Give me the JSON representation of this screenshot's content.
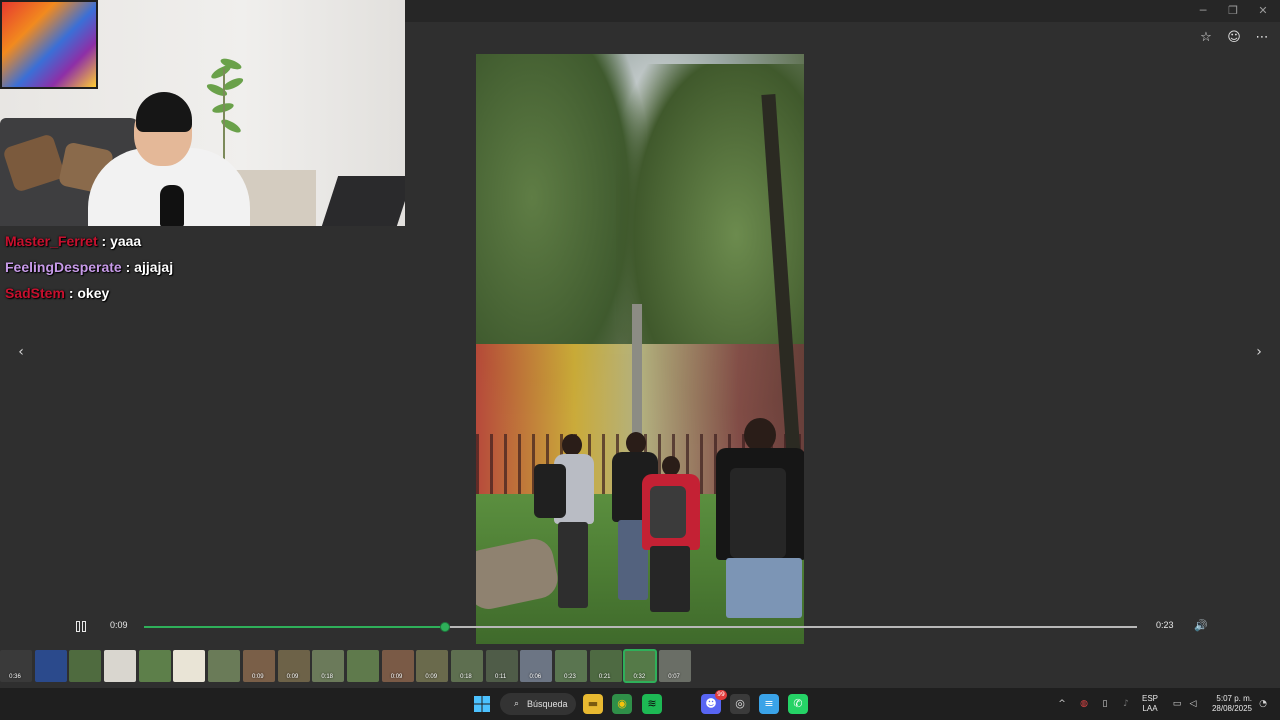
{
  "window": {
    "minimize_glyph": "─",
    "maximize_glyph": "❐",
    "close_glyph": "✕"
  },
  "toolbar": {
    "favorite_icon": "star-icon",
    "favorite_glyph": "☆",
    "emoji_icon": "smiley-icon",
    "emoji_glyph": "☺",
    "more_icon": "ellipsis-icon",
    "more_glyph": "⋯"
  },
  "chat": {
    "messages": [
      {
        "user": "Master_Ferret",
        "user_color": "#c8102e",
        "separator": ":",
        "text": "yaaa"
      },
      {
        "user": "FeelingDesperate",
        "user_color": "#c79ae8",
        "separator": ":",
        "text": "ajjajaj"
      },
      {
        "user": "SadStem",
        "user_color": "#c8102e",
        "separator": ":",
        "text": "okey"
      }
    ]
  },
  "nav": {
    "prev_glyph": "‹",
    "next_glyph": "›"
  },
  "player": {
    "current_time": "0:09",
    "total_time": "0:23",
    "progress": 0.303,
    "volume_glyph": "🔊",
    "accent_color": "#2fb05a"
  },
  "filmstrip": {
    "thumbnails": [
      {
        "duration": "0:36",
        "color": "#3a3a3a",
        "selected": false
      },
      {
        "duration": "",
        "color": "#2b4a8c",
        "selected": false
      },
      {
        "duration": "",
        "color": "#4f6b3f",
        "selected": false
      },
      {
        "duration": "",
        "color": "#d9d6cf",
        "selected": false
      },
      {
        "duration": "",
        "color": "#5d7f4a",
        "selected": false
      },
      {
        "duration": "",
        "color": "#e9e4d6",
        "selected": false
      },
      {
        "duration": "",
        "color": "#6a7b58",
        "selected": false
      },
      {
        "duration": "0:09",
        "color": "#7a5f48",
        "selected": false
      },
      {
        "duration": "0:09",
        "color": "#6d6248",
        "selected": false
      },
      {
        "duration": "0:18",
        "color": "#6b7a5a",
        "selected": false
      },
      {
        "duration": "",
        "color": "#5f7a4c",
        "selected": false
      },
      {
        "duration": "0:09",
        "color": "#7a5a46",
        "selected": false
      },
      {
        "duration": "0:09",
        "color": "#6a6a4c",
        "selected": false
      },
      {
        "duration": "0:18",
        "color": "#5e6f50",
        "selected": false
      },
      {
        "duration": "0:11",
        "color": "#4f5c48",
        "selected": false
      },
      {
        "duration": "0:06",
        "color": "#6c7584",
        "selected": false
      },
      {
        "duration": "0:23",
        "color": "#5a7550",
        "selected": false
      },
      {
        "duration": "0:21",
        "color": "#4e6a42",
        "selected": false
      },
      {
        "duration": "0:32",
        "color": "#557a48",
        "selected": true
      },
      {
        "duration": "0:07",
        "color": "#6a6e66",
        "selected": false
      }
    ]
  },
  "taskbar": {
    "search_label": "Búsqueda",
    "search_glyph": "⌕",
    "start_icon": "windows-start-icon",
    "apps": [
      {
        "name": "file-explorer-icon",
        "glyph": "▬",
        "bg": "#e8b931",
        "fg": "#7a5a10"
      },
      {
        "name": "chrome-icon",
        "glyph": "◉",
        "bg": "#2f8f48",
        "fg": "#f4c20d"
      },
      {
        "name": "spotify-icon",
        "glyph": "≋",
        "bg": "#1db954",
        "fg": "#0d0d0d"
      },
      {
        "name": "discord-icon",
        "glyph": "☻",
        "bg": "#5865f2",
        "fg": "#ffffff",
        "badge": "99"
      },
      {
        "name": "obs-icon",
        "glyph": "◎",
        "bg": "#3a3a3a",
        "fg": "#e0e0e0"
      },
      {
        "name": "notepad-icon",
        "glyph": "≡",
        "bg": "#3aa3e8",
        "fg": "#ffffff"
      },
      {
        "name": "whatsapp-icon",
        "glyph": "✆",
        "bg": "#25d366",
        "fg": "#ffffff"
      }
    ],
    "tray_chevron": "^",
    "language_line1": "ESP",
    "language_line2": "LAA",
    "time": "5:07 p. m.",
    "date": "28/08/2025"
  }
}
